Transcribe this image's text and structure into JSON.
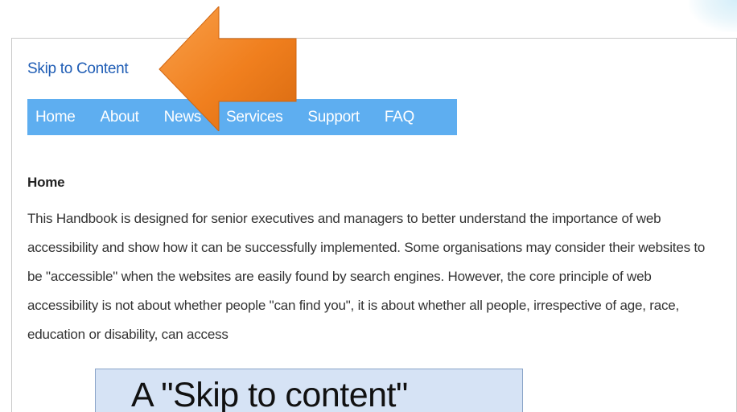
{
  "skip_link": {
    "label": "Skip to Content"
  },
  "nav": {
    "items": [
      {
        "label": "Home"
      },
      {
        "label": "About"
      },
      {
        "label": "News"
      },
      {
        "label": "Services"
      },
      {
        "label": "Support"
      },
      {
        "label": "FAQ"
      }
    ]
  },
  "content": {
    "heading": "Home",
    "paragraph": "This Handbook is designed for senior executives and managers to better understand the importance of web accessibility and show how it can be successfully implemented. Some organisations may consider their websites to be \"accessible\" when the websites are easily found by search engines. However, the core principle of web accessibility is not about whether people \"can find you\", it is about whether all people, irrespective of age, race, education or disability, can access"
  },
  "callout": {
    "text": "A \"Skip to content\""
  },
  "colors": {
    "link": "#1f5db5",
    "nav_background": "#5eaef0",
    "arrow": "#f07f1e",
    "callout_background": "#d6e3f5"
  }
}
